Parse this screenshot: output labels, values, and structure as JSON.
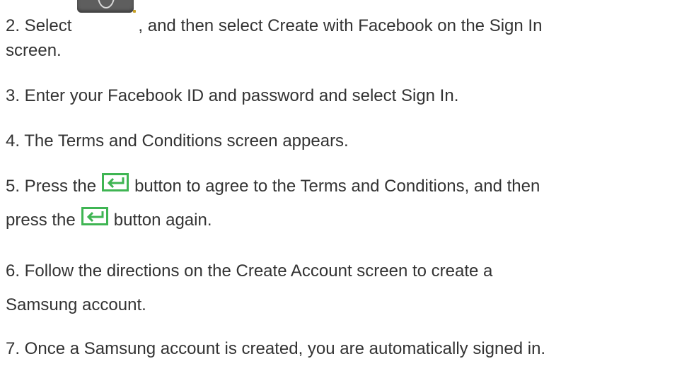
{
  "steps": [
    {
      "part1": "2. Select",
      "part2": ", and then select Create with Facebook on the Sign In",
      "part3": "screen."
    },
    {
      "text": "3. Enter your Facebook ID and password and select Sign In."
    },
    {
      "text": "4. The Terms and Conditions screen appears."
    },
    {
      "part1": "5. Press the",
      "part2": "button to agree to the Terms and Conditions, and then",
      "part3": "press the",
      "part4": "button again."
    },
    {
      "line1": "6. Follow the directions on the Create Account screen to create a",
      "line2": "Samsung account."
    },
    {
      "text": "7. Once a Samsung account is created, you are automatically signed in."
    }
  ],
  "icons": {
    "settings": "remote-settings-icon",
    "return": "return-icon"
  },
  "colors": {
    "text": "#333333",
    "return_icon": "#3fb553",
    "settings_icon": "#5e5e5e"
  }
}
